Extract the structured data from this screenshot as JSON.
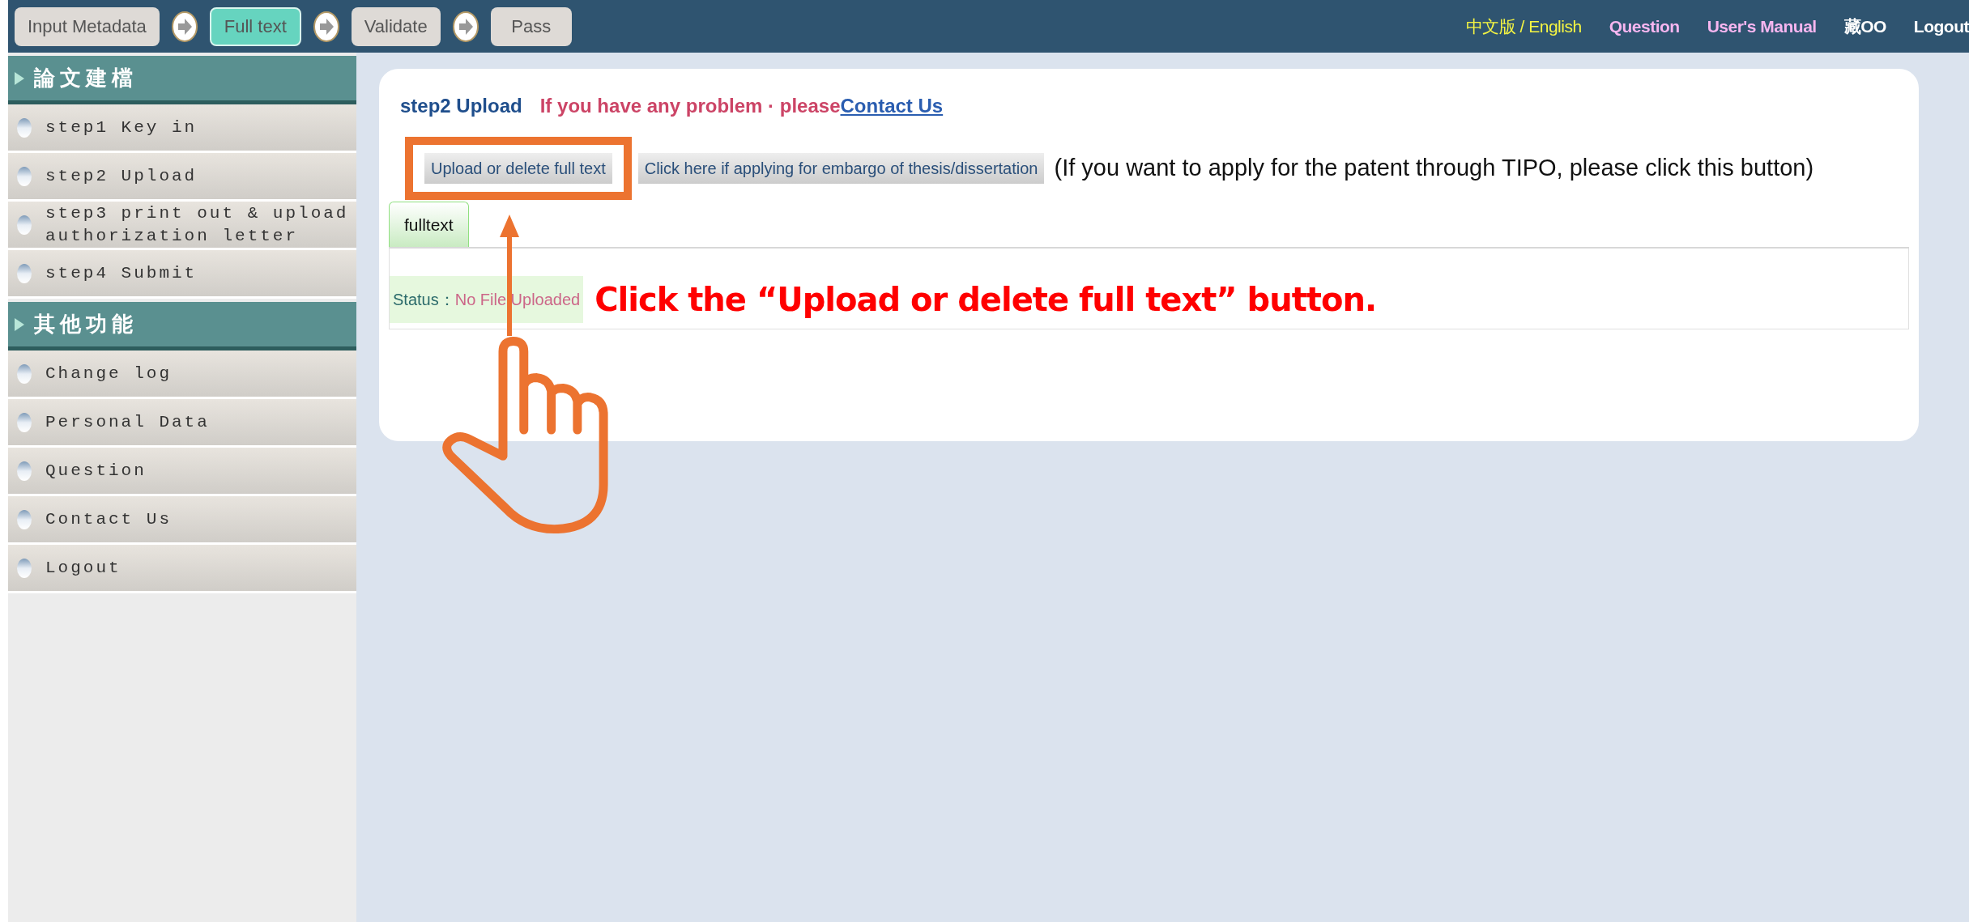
{
  "steps": [
    {
      "label": "Input Metadata",
      "selected": false
    },
    {
      "label": "Full text",
      "selected": true
    },
    {
      "label": "Validate",
      "selected": false
    },
    {
      "label": "Pass",
      "selected": false
    }
  ],
  "top_links": [
    {
      "label": "中文版 / English",
      "kind": "language"
    },
    {
      "label": "Question",
      "kind": "link"
    },
    {
      "label": "User's Manual",
      "kind": "link"
    },
    {
      "label": "藏OO",
      "kind": "user"
    },
    {
      "label": "Logout",
      "kind": "logout"
    }
  ],
  "sidebar": {
    "sections": [
      {
        "title": "論文建檔",
        "items": [
          "step1 Key in",
          "step2 Upload",
          "step3 print out & upload authorization letter",
          "step4 Submit"
        ]
      },
      {
        "title": "其他功能",
        "items": [
          "Change log",
          "Personal Data",
          "Question",
          "Contact Us",
          "Logout"
        ]
      }
    ]
  },
  "content": {
    "step_title": "step2 Upload",
    "help_text": "If you have any problem · please",
    "help_link": "Contact Us",
    "buttons": [
      "Upload or delete full text",
      "Click here if applying for embargo of thesis/dissertation"
    ],
    "patent_note": "(If you want to apply for the patent through TIPO, please click this button)",
    "tabs": [
      {
        "label": "fulltext",
        "selected": true
      }
    ],
    "status_label": "Status：",
    "status_value": "No File Uploaded"
  },
  "annotation": {
    "callout": "Click the “Upload or delete full text” button."
  }
}
